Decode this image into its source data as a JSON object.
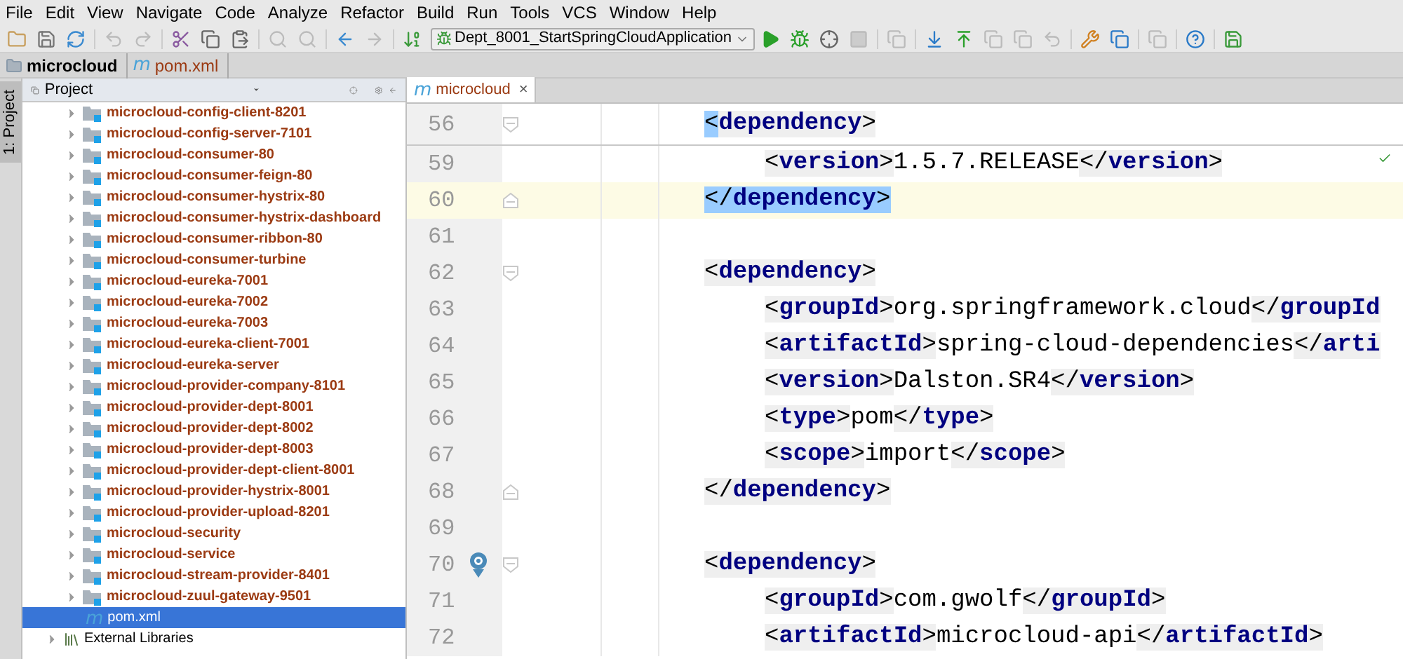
{
  "menu": [
    "File",
    "Edit",
    "View",
    "Navigate",
    "Code",
    "Analyze",
    "Refactor",
    "Build",
    "Run",
    "Tools",
    "VCS",
    "Window",
    "Help"
  ],
  "toolbar": {
    "run_config": "Dept_8001_StartSpringCloudApplication"
  },
  "breadcrumb": [
    {
      "kind": "folder",
      "label": "microcloud"
    },
    {
      "kind": "maven",
      "glyph": "m",
      "label": "pom.xml"
    }
  ],
  "tool_stripe": {
    "label": "1: Project",
    "selected": true
  },
  "project": {
    "title": "Project",
    "items": [
      {
        "kind": "module",
        "label": "microcloud-config-client-8201",
        "selected": false
      },
      {
        "kind": "module",
        "label": "microcloud-config-server-7101",
        "selected": false
      },
      {
        "kind": "module",
        "label": "microcloud-consumer-80",
        "selected": false
      },
      {
        "kind": "module",
        "label": "microcloud-consumer-feign-80",
        "selected": false
      },
      {
        "kind": "module",
        "label": "microcloud-consumer-hystrix-80",
        "selected": false
      },
      {
        "kind": "module",
        "label": "microcloud-consumer-hystrix-dashboard",
        "selected": false
      },
      {
        "kind": "module",
        "label": "microcloud-consumer-ribbon-80",
        "selected": false
      },
      {
        "kind": "module",
        "label": "microcloud-consumer-turbine",
        "selected": false
      },
      {
        "kind": "module",
        "label": "microcloud-eureka-7001",
        "selected": false
      },
      {
        "kind": "module",
        "label": "microcloud-eureka-7002",
        "selected": false
      },
      {
        "kind": "module",
        "label": "microcloud-eureka-7003",
        "selected": false
      },
      {
        "kind": "module",
        "label": "microcloud-eureka-client-7001",
        "selected": false
      },
      {
        "kind": "module",
        "label": "microcloud-eureka-server",
        "selected": false
      },
      {
        "kind": "module",
        "label": "microcloud-provider-company-8101",
        "selected": false
      },
      {
        "kind": "module",
        "label": "microcloud-provider-dept-8001",
        "selected": false
      },
      {
        "kind": "module",
        "label": "microcloud-provider-dept-8002",
        "selected": false
      },
      {
        "kind": "module",
        "label": "microcloud-provider-dept-8003",
        "selected": false
      },
      {
        "kind": "module",
        "label": "microcloud-provider-dept-client-8001",
        "selected": false
      },
      {
        "kind": "module",
        "label": "microcloud-provider-hystrix-8001",
        "selected": false
      },
      {
        "kind": "module",
        "label": "microcloud-provider-upload-8201",
        "selected": false
      },
      {
        "kind": "module",
        "label": "microcloud-security",
        "selected": false
      },
      {
        "kind": "module",
        "label": "microcloud-service",
        "selected": false
      },
      {
        "kind": "module",
        "label": "microcloud-stream-provider-8401",
        "selected": false
      },
      {
        "kind": "module",
        "label": "microcloud-zuul-gateway-9501",
        "selected": false
      },
      {
        "kind": "file",
        "glyph": "m",
        "label": "pom.xml",
        "selected": true
      },
      {
        "kind": "library",
        "label": "External Libraries",
        "selected": false
      }
    ]
  },
  "editor": {
    "tabs": [
      {
        "glyph": "m",
        "label": "microcloud",
        "close": "×",
        "selected": true
      }
    ],
    "sticky_line": {
      "number": "56",
      "fold_start": true,
      "current": false,
      "segments": [
        {
          "kind": "punct",
          "text": "<",
          "matched": true
        },
        {
          "kind": "tag",
          "text": "dependency",
          "matched": false
        },
        {
          "kind": "punct",
          "text": ">",
          "matched": false
        }
      ],
      "children": [
        {
          "number": "59",
          "current": false,
          "segments": [
            {
              "kind": "punct",
              "text": "<"
            },
            {
              "kind": "tag",
              "text": "version"
            },
            {
              "kind": "punct",
              "text": ">"
            },
            {
              "kind": "value",
              "text": "1.5.7.RELEASE"
            },
            {
              "kind": "punct",
              "text": "</"
            },
            {
              "kind": "tag",
              "text": "version"
            },
            {
              "kind": "punct",
              "text": ">"
            }
          ]
        }
      ]
    },
    "lines": [
      {
        "number": "60",
        "fold_end": true,
        "current": true,
        "segments": [
          {
            "kind": "punct",
            "text": "</",
            "matched": true
          },
          {
            "kind": "tag",
            "text": "dependency",
            "matched": true
          },
          {
            "kind": "punct",
            "text": ">",
            "matched": true
          }
        ]
      },
      {
        "number": "61",
        "current": false
      },
      {
        "number": "62",
        "fold_start": true,
        "current": false,
        "segments": [
          {
            "kind": "punct",
            "text": "<"
          },
          {
            "kind": "tag",
            "text": "dependency"
          },
          {
            "kind": "punct",
            "text": ">"
          }
        ],
        "children": [
          {
            "number": "63",
            "current": false,
            "segments": [
              {
                "kind": "punct",
                "text": "<"
              },
              {
                "kind": "tag",
                "text": "groupId"
              },
              {
                "kind": "punct",
                "text": ">"
              },
              {
                "kind": "value",
                "text": "org.springframework.cloud"
              },
              {
                "kind": "punct",
                "text": "</"
              },
              {
                "kind": "tag",
                "text": "groupId"
              }
            ]
          },
          {
            "number": "64",
            "current": false,
            "segments": [
              {
                "kind": "punct",
                "text": "<"
              },
              {
                "kind": "tag",
                "text": "artifactId"
              },
              {
                "kind": "punct",
                "text": ">"
              },
              {
                "kind": "value",
                "text": "spring-cloud-dependencies"
              },
              {
                "kind": "punct",
                "text": "</"
              },
              {
                "kind": "tag",
                "text": "arti"
              }
            ]
          },
          {
            "number": "65",
            "current": false,
            "segments": [
              {
                "kind": "punct",
                "text": "<"
              },
              {
                "kind": "tag",
                "text": "version"
              },
              {
                "kind": "punct",
                "text": ">"
              },
              {
                "kind": "value",
                "text": "Dalston.SR4"
              },
              {
                "kind": "punct",
                "text": "</"
              },
              {
                "kind": "tag",
                "text": "version"
              },
              {
                "kind": "punct",
                "text": ">"
              }
            ]
          },
          {
            "number": "66",
            "current": false,
            "segments": [
              {
                "kind": "punct",
                "text": "<"
              },
              {
                "kind": "tag",
                "text": "type"
              },
              {
                "kind": "punct",
                "text": ">"
              },
              {
                "kind": "value",
                "text": "pom"
              },
              {
                "kind": "punct",
                "text": "</"
              },
              {
                "kind": "tag",
                "text": "type"
              },
              {
                "kind": "punct",
                "text": ">"
              }
            ]
          },
          {
            "number": "67",
            "current": false,
            "segments": [
              {
                "kind": "punct",
                "text": "<"
              },
              {
                "kind": "tag",
                "text": "scope"
              },
              {
                "kind": "punct",
                "text": ">"
              },
              {
                "kind": "value",
                "text": "import"
              },
              {
                "kind": "punct",
                "text": "</"
              },
              {
                "kind": "tag",
                "text": "scope"
              },
              {
                "kind": "punct",
                "text": ">"
              }
            ]
          }
        ]
      },
      {
        "number": "68",
        "fold_end": true,
        "current": false,
        "segments": [
          {
            "kind": "punct",
            "text": "</"
          },
          {
            "kind": "tag",
            "text": "dependency"
          },
          {
            "kind": "punct",
            "text": ">"
          }
        ]
      },
      {
        "number": "69",
        "current": false
      },
      {
        "number": "70",
        "fold_start": true,
        "marker": true,
        "current": false,
        "segments": [
          {
            "kind": "punct",
            "text": "<"
          },
          {
            "kind": "tag",
            "text": "dependency"
          },
          {
            "kind": "punct",
            "text": ">"
          }
        ],
        "children": [
          {
            "number": "71",
            "current": false,
            "segments": [
              {
                "kind": "punct",
                "text": "<"
              },
              {
                "kind": "tag",
                "text": "groupId"
              },
              {
                "kind": "punct",
                "text": ">"
              },
              {
                "kind": "value",
                "text": "com.gwolf"
              },
              {
                "kind": "punct",
                "text": "</"
              },
              {
                "kind": "tag",
                "text": "groupId"
              },
              {
                "kind": "punct",
                "text": ">"
              }
            ]
          },
          {
            "number": "72",
            "current": false,
            "segments": [
              {
                "kind": "punct",
                "text": "<"
              },
              {
                "kind": "tag",
                "text": "artifactId"
              },
              {
                "kind": "punct",
                "text": ">"
              },
              {
                "kind": "value",
                "text": "microcloud-api"
              },
              {
                "kind": "punct",
                "text": "</"
              },
              {
                "kind": "tag",
                "text": "artifactId"
              },
              {
                "kind": "punct",
                "text": ">"
              }
            ]
          }
        ]
      }
    ]
  }
}
